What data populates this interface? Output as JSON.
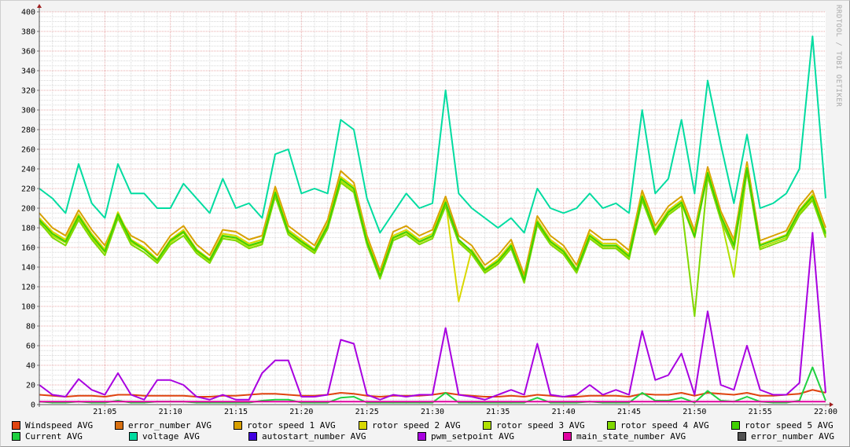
{
  "watermark": "RRDTOOL / TOBI OETIKER",
  "chart_data": {
    "type": "line",
    "title": "",
    "xlabel": "",
    "ylabel": "",
    "ylim": [
      0,
      400
    ],
    "xlim_minutes": [
      0,
      60
    ],
    "grid": true,
    "legend_placement": "bottom",
    "y_ticks": [
      "0",
      "20",
      "40",
      "60",
      "80",
      "100",
      "120",
      "140",
      "160",
      "180",
      "200",
      "220",
      "240",
      "260",
      "280",
      "300",
      "320",
      "340",
      "360",
      "380",
      "400"
    ],
    "x_ticks": [
      {
        "minute": 5,
        "label": "21:05"
      },
      {
        "minute": 10,
        "label": "21:10"
      },
      {
        "minute": 15,
        "label": "21:15"
      },
      {
        "minute": 20,
        "label": "21:20"
      },
      {
        "minute": 25,
        "label": "21:25"
      },
      {
        "minute": 30,
        "label": "21:30"
      },
      {
        "minute": 35,
        "label": "21:35"
      },
      {
        "minute": 40,
        "label": "21:40"
      },
      {
        "minute": 45,
        "label": "21:45"
      },
      {
        "minute": 50,
        "label": "21:50"
      },
      {
        "minute": 55,
        "label": "21:55"
      },
      {
        "minute": 60,
        "label": "22:00"
      }
    ],
    "x_start_label": "21:00",
    "x_step_minutes": 1,
    "series": [
      {
        "name": "Windspeed AVG",
        "color": "#e04410",
        "values": [
          10,
          9,
          8,
          9,
          9,
          8,
          10,
          10,
          9,
          9,
          9,
          9,
          8,
          8,
          9,
          9,
          10,
          11,
          11,
          10,
          9,
          9,
          10,
          12,
          11,
          9,
          8,
          9,
          9,
          9,
          10,
          12,
          10,
          9,
          8,
          8,
          9,
          8,
          10,
          9,
          8,
          8,
          9,
          9,
          9,
          8,
          11,
          10,
          10,
          12,
          9,
          12,
          11,
          10,
          12,
          9,
          9,
          10,
          11,
          15,
          12
        ]
      },
      {
        "name": "error_number AVG",
        "color": "#d87010",
        "values": []
      },
      {
        "name": "rotor speed 1 AVG",
        "color": "#d8a000",
        "values": [
          195,
          180,
          172,
          198,
          178,
          162,
          192,
          172,
          165,
          152,
          172,
          182,
          163,
          152,
          178,
          176,
          168,
          172,
          222,
          182,
          172,
          162,
          188,
          238,
          226,
          172,
          136,
          176,
          182,
          172,
          178,
          212,
          172,
          162,
          142,
          152,
          168,
          132,
          192,
          172,
          162,
          142,
          178,
          168,
          168,
          157,
          218,
          182,
          202,
          212,
          177,
          242,
          197,
          168,
          247,
          167,
          172,
          177,
          202,
          218,
          180
        ]
      },
      {
        "name": "rotor speed 2 AVG",
        "color": "#d8d800",
        "values": [
          190,
          176,
          168,
          194,
          174,
          158,
          196,
          168,
          160,
          148,
          168,
          178,
          158,
          148,
          174,
          172,
          164,
          168,
          218,
          178,
          168,
          158,
          184,
          232,
          222,
          168,
          132,
          172,
          178,
          168,
          174,
          208,
          105,
          158,
          138,
          148,
          164,
          128,
          188,
          168,
          158,
          138,
          174,
          164,
          164,
          153,
          214,
          178,
          198,
          208,
          173,
          238,
          193,
          164,
          243,
          163,
          168,
          173,
          198,
          214,
          176
        ]
      },
      {
        "name": "rotor speed 3 AVG",
        "color": "#b0e000",
        "values": [
          185,
          172,
          165,
          190,
          170,
          155,
          192,
          165,
          158,
          146,
          165,
          175,
          156,
          146,
          171,
          169,
          161,
          165,
          214,
          175,
          165,
          156,
          181,
          228,
          218,
          165,
          130,
          169,
          175,
          165,
          171,
          205,
          167,
          155,
          136,
          145,
          161,
          126,
          185,
          165,
          155,
          136,
          171,
          161,
          161,
          150,
          210,
          175,
          195,
          205,
          170,
          234,
          190,
          130,
          239,
          160,
          165,
          170,
          195,
          210,
          172
        ]
      },
      {
        "name": "rotor speed 4 AVG",
        "color": "#80d800",
        "values": [
          186,
          170,
          162,
          188,
          168,
          152,
          190,
          163,
          155,
          144,
          163,
          172,
          154,
          144,
          169,
          167,
          159,
          163,
          212,
          173,
          163,
          154,
          179,
          226,
          216,
          163,
          128,
          167,
          173,
          163,
          169,
          202,
          165,
          153,
          134,
          143,
          159,
          124,
          183,
          163,
          153,
          134,
          169,
          159,
          159,
          148,
          208,
          173,
          193,
          203,
          90,
          232,
          188,
          158,
          237,
          158,
          163,
          168,
          193,
          208,
          170
        ]
      },
      {
        "name": "rotor speed 5 AVG",
        "color": "#40d000",
        "values": [
          188,
          174,
          166,
          192,
          172,
          156,
          194,
          167,
          158,
          147,
          167,
          176,
          157,
          147,
          172,
          170,
          162,
          166,
          216,
          176,
          166,
          157,
          182,
          230,
          220,
          166,
          131,
          170,
          176,
          166,
          172,
          206,
          168,
          156,
          137,
          146,
          162,
          127,
          186,
          166,
          156,
          137,
          172,
          162,
          162,
          151,
          212,
          176,
          196,
          206,
          171,
          236,
          192,
          162,
          241,
          162,
          167,
          172,
          197,
          212,
          174
        ]
      },
      {
        "name": "Current AVG",
        "color": "#20d040",
        "values": [
          3,
          2,
          2,
          3,
          2,
          2,
          4,
          2,
          2,
          3,
          3,
          3,
          2,
          2,
          2,
          2,
          2,
          4,
          5,
          5,
          2,
          2,
          2,
          7,
          8,
          2,
          2,
          2,
          2,
          2,
          2,
          12,
          2,
          2,
          2,
          2,
          2,
          2,
          7,
          2,
          2,
          2,
          3,
          2,
          2,
          2,
          12,
          4,
          4,
          7,
          2,
          14,
          4,
          3,
          8,
          3,
          2,
          2,
          4,
          38,
          4
        ]
      },
      {
        "name": "voltage AVG",
        "color": "#00dca0",
        "values": [
          220,
          210,
          195,
          245,
          205,
          190,
          245,
          215,
          215,
          200,
          200,
          225,
          210,
          195,
          230,
          200,
          205,
          190,
          255,
          260,
          215,
          220,
          215,
          290,
          280,
          210,
          175,
          195,
          215,
          200,
          205,
          320,
          215,
          200,
          190,
          180,
          190,
          175,
          220,
          200,
          195,
          200,
          215,
          200,
          205,
          195,
          300,
          215,
          230,
          290,
          215,
          330,
          265,
          205,
          275,
          200,
          205,
          215,
          240,
          375,
          210
        ]
      },
      {
        "name": "autostart_number AVG",
        "color": "#4000e0",
        "values": []
      },
      {
        "name": "pwm_setpoint AVG",
        "color": "#a800e0",
        "values": [
          20,
          10,
          8,
          26,
          15,
          10,
          32,
          10,
          5,
          25,
          25,
          20,
          8,
          5,
          10,
          5,
          5,
          32,
          45,
          45,
          8,
          8,
          10,
          66,
          62,
          10,
          5,
          10,
          8,
          10,
          10,
          78,
          10,
          8,
          5,
          10,
          15,
          10,
          62,
          10,
          8,
          10,
          20,
          10,
          15,
          10,
          75,
          25,
          30,
          52,
          10,
          95,
          20,
          15,
          60,
          15,
          10,
          10,
          22,
          175,
          12
        ]
      },
      {
        "name": "main_state_number AVG",
        "color": "#e000a0",
        "values": [
          3,
          3,
          3,
          3,
          3,
          3,
          3,
          3,
          3,
          3,
          3,
          3,
          3,
          3,
          3,
          3,
          3,
          3,
          3,
          3,
          3,
          3,
          3,
          3,
          3,
          3,
          3,
          3,
          3,
          3,
          3,
          3,
          3,
          3,
          3,
          3,
          3,
          3,
          3,
          3,
          3,
          3,
          3,
          3,
          3,
          3,
          3,
          3,
          3,
          3,
          3,
          3,
          3,
          3,
          3,
          3,
          3,
          3,
          3,
          3,
          3
        ]
      },
      {
        "name": "error_number AVG",
        "color": "#505050",
        "values": []
      }
    ]
  }
}
